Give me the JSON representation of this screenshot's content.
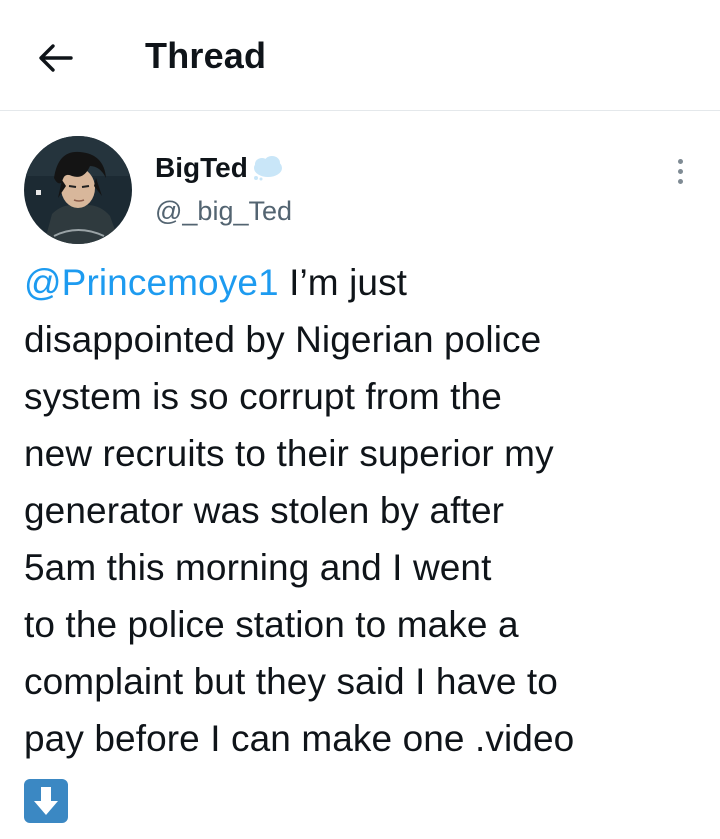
{
  "header": {
    "title": "Thread",
    "back_icon": "arrow-left-icon"
  },
  "tweet": {
    "author": {
      "display_name": "BigTed",
      "handle": "@_big_Ted",
      "name_emoji": "cloud-emoji"
    },
    "mention": "@Princemoye1",
    "lines": [
      " I’m just",
      "disappointed by Nigerian police",
      "system is so corrupt from the",
      "new recruits to their superior my",
      "generator was stolen by after",
      "5am this morning and I went",
      "to the police station to make a",
      "complaint but they said I have to",
      "pay before I can make one .video"
    ],
    "trailing_emoji": "down-arrow-emoji",
    "more_icon": "more-vertical-icon"
  },
  "colors": {
    "link": "#1d9bf0",
    "secondary_text": "#536471",
    "divider": "#e4e8eb",
    "emoji_blue": "#3b88c3"
  }
}
